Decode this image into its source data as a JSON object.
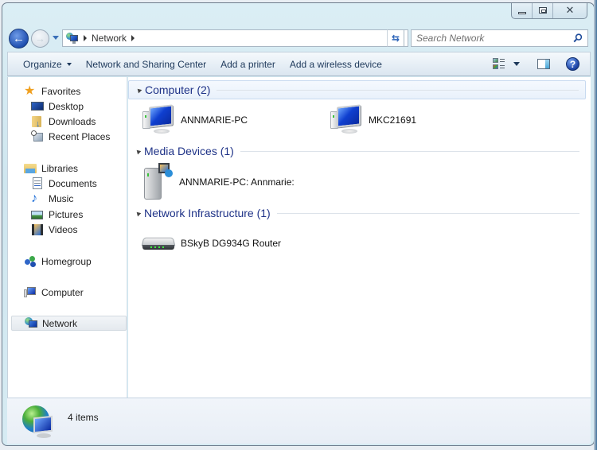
{
  "window": {
    "caption_buttons": [
      "minimize",
      "maximize",
      "close"
    ]
  },
  "address_bar": {
    "location_icon": "network-icon",
    "breadcrumbs": [
      "Network"
    ],
    "search_placeholder": "Search Network"
  },
  "command_bar": {
    "organize": "Organize",
    "items": [
      "Network and Sharing Center",
      "Add a printer",
      "Add a wireless device"
    ]
  },
  "nav_pane": {
    "favorites": {
      "label": "Favorites",
      "items": [
        "Desktop",
        "Downloads",
        "Recent Places"
      ]
    },
    "libraries": {
      "label": "Libraries",
      "items": [
        "Documents",
        "Music",
        "Pictures",
        "Videos"
      ]
    },
    "homegroup": "Homegroup",
    "computer": "Computer",
    "network": "Network",
    "selected": "Network"
  },
  "content": {
    "groups": [
      {
        "title": "Computer (2)",
        "items": [
          "ANNMARIE-PC",
          "MKC21691"
        ]
      },
      {
        "title": "Media Devices (1)",
        "items": [
          "ANNMARIE-PC: Annmarie:"
        ]
      },
      {
        "title": "Network Infrastructure (1)",
        "items": [
          "BSkyB DG934G Router"
        ]
      }
    ]
  },
  "status_bar": {
    "count_text": "4 items"
  }
}
